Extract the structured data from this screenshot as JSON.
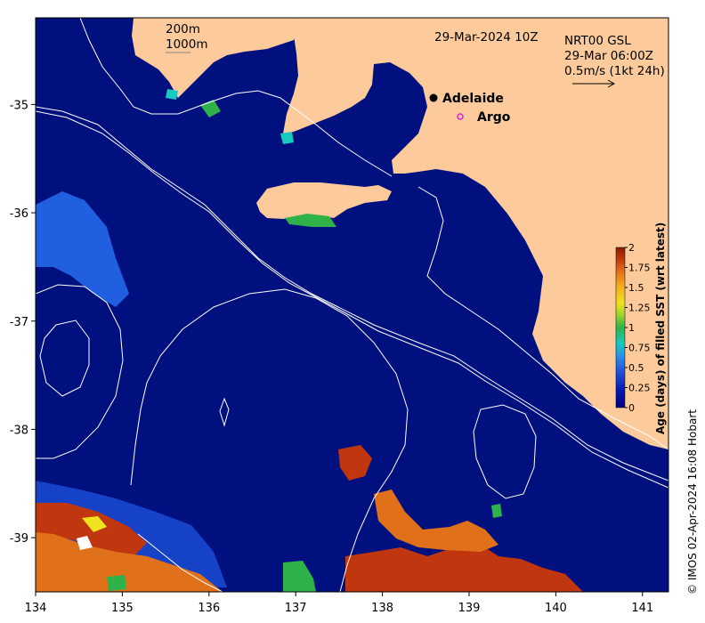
{
  "map": {
    "timestamp": "29-Mar-2024 10Z",
    "contour_legend": [
      "200m",
      "1000m"
    ],
    "current_info": [
      "NRT00 GSL",
      "29-Mar 06:00Z",
      "0.5m/s (1kt 24h)"
    ],
    "places": [
      {
        "name": "Adelaide",
        "lon": 138.6,
        "lat": -34.93,
        "marker": "filled-dot"
      },
      {
        "name": "Argo",
        "lon": 138.89,
        "lat": -35.12,
        "marker": "open-circle-magenta"
      }
    ],
    "x_ticks": [
      "134",
      "135",
      "136",
      "137",
      "138",
      "139",
      "140",
      "141"
    ],
    "y_ticks": [
      "-35",
      "-36",
      "-37",
      "-38",
      "-39"
    ],
    "lon_range": [
      134.0,
      141.3
    ],
    "lat_range": [
      -39.5,
      -34.2
    ],
    "credit": "© IMOS 02-Apr-2024 16:08 Hobart"
  },
  "colorbar": {
    "title": "Age (days) of filled SST (wrt latest)",
    "ticks": [
      "2",
      "1.75",
      "1.5",
      "1.25",
      "1",
      "0.75",
      "0.5",
      "0.25",
      "0"
    ],
    "colors": [
      "#00007a",
      "#0016b0",
      "#1f4fd8",
      "#2a8ee8",
      "#18c9c0",
      "#2fb24a",
      "#9fd42a",
      "#f0e21e",
      "#f4b21a",
      "#e0701a",
      "#c0360e",
      "#8a1a04"
    ]
  },
  "colors": {
    "ocean": "#00107f",
    "land": "#fdcb9b",
    "contour": "#ffffff"
  }
}
